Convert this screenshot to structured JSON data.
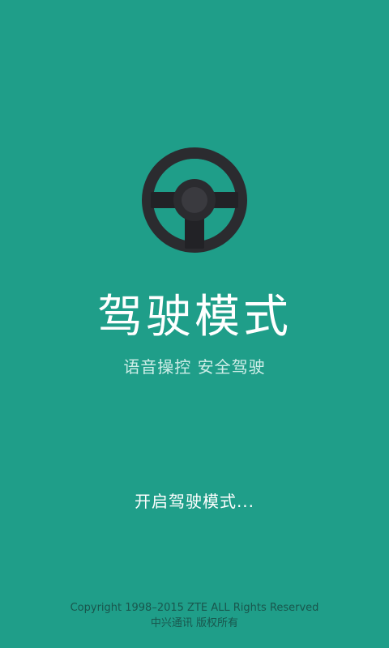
{
  "app": {
    "title": "驾驶模式",
    "subtitle": "语音操控  安全驾驶",
    "status_text": "开启驾驶模式...",
    "logo_icon": "steering-wheel-icon"
  },
  "footer": {
    "copyright": "Copyright 1998–2015 ZTE ALL Rights Reserved",
    "rights_cn": "中兴通讯 版权所有"
  },
  "colors": {
    "background": "#1f9e89",
    "wheel_dark": "#2b2b2f",
    "wheel_hub": "#3a3a3f",
    "text_primary": "#ffffff",
    "text_secondary": "#cfeee8",
    "footer_text": "#19564d"
  }
}
